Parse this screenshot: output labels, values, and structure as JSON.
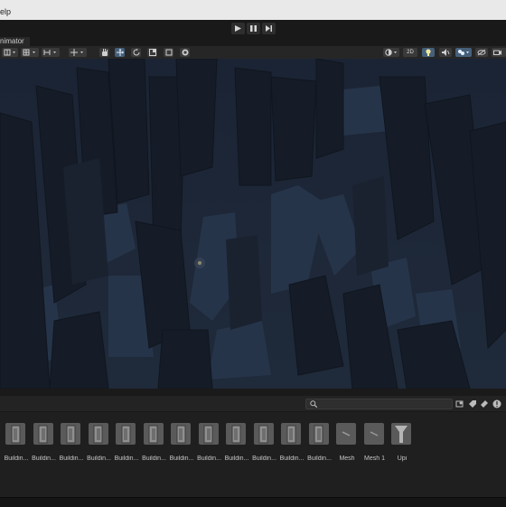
{
  "menubar": {
    "fragment": "elp"
  },
  "playbar": {
    "play_icon": "play-icon",
    "pause_icon": "pause-icon",
    "step_icon": "step-icon"
  },
  "tabs": {
    "animator_label": "nimator"
  },
  "toolbar": {
    "view_2d_label": "2D",
    "tools": [
      "hand-tool-icon",
      "move-tool-icon",
      "rotate-tool-icon",
      "scale-tool-icon",
      "rect-tool-icon",
      "transform-tool-icon"
    ]
  },
  "project": {
    "search_placeholder": "",
    "assets": [
      {
        "name": "Buildin...",
        "icon": "building-icon"
      },
      {
        "name": "Buildin...",
        "icon": "building-icon"
      },
      {
        "name": "Buildin...",
        "icon": "building-icon"
      },
      {
        "name": "Buildin...",
        "icon": "building-icon"
      },
      {
        "name": "Buildin...",
        "icon": "building-icon"
      },
      {
        "name": "Buildin...",
        "icon": "building-icon"
      },
      {
        "name": "Buildin...",
        "icon": "building-icon"
      },
      {
        "name": "Buildin...",
        "icon": "building-icon"
      },
      {
        "name": "Buildin...",
        "icon": "building-icon"
      },
      {
        "name": "Buildin...",
        "icon": "building-icon"
      },
      {
        "name": "Buildin...",
        "icon": "building-icon"
      },
      {
        "name": "Buildin...",
        "icon": "building-icon"
      },
      {
        "name": "Mesh",
        "icon": "mesh-icon"
      },
      {
        "name": "Mesh 1",
        "icon": "mesh-icon"
      },
      {
        "name": "Upi",
        "icon": "upi-icon"
      }
    ]
  },
  "colors": {
    "accent": "#46607a",
    "scene_sky": "#1c2533",
    "panel": "#262626"
  }
}
